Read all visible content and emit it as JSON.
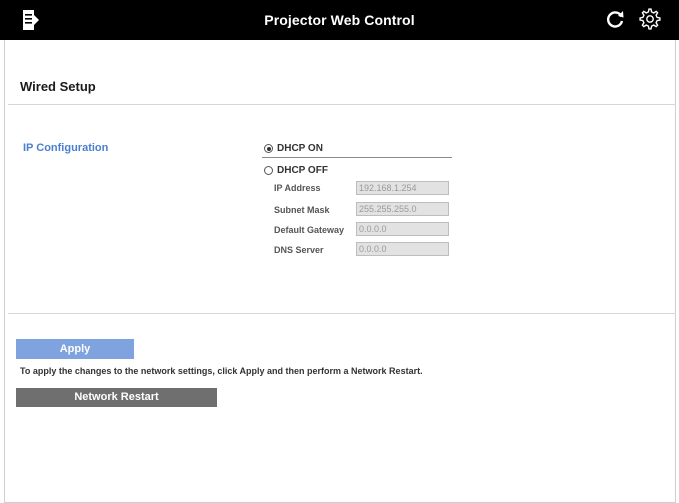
{
  "header": {
    "title": "Projector Web Control",
    "menu_icon": "menu-icon",
    "refresh_icon": "refresh-icon",
    "settings_icon": "gear-icon",
    "bar_color": "#000000"
  },
  "section": {
    "title": "Wired Setup"
  },
  "ip_config": {
    "label": "IP Configuration",
    "label_color": "#4a7fd0",
    "dhcp_on": {
      "label": "DHCP ON",
      "selected": true
    },
    "dhcp_off": {
      "label": "DHCP OFF",
      "selected": false
    },
    "fields": {
      "ip_address": {
        "label": "IP Address",
        "value": "192.168.1.254"
      },
      "subnet_mask": {
        "label": "Subnet Mask",
        "value": "255.255.255.0"
      },
      "default_gateway": {
        "label": "Default Gateway",
        "value": "0.0.0.0"
      },
      "dns_server": {
        "label": "DNS Server",
        "value": "0.0.0.0"
      }
    }
  },
  "actions": {
    "apply_label": "Apply",
    "apply_color": "#7ea3de",
    "hint": "To apply the changes to the network settings, click Apply and then perform a Network Restart.",
    "restart_label": "Network Restart",
    "restart_color": "#6f6f6f"
  }
}
